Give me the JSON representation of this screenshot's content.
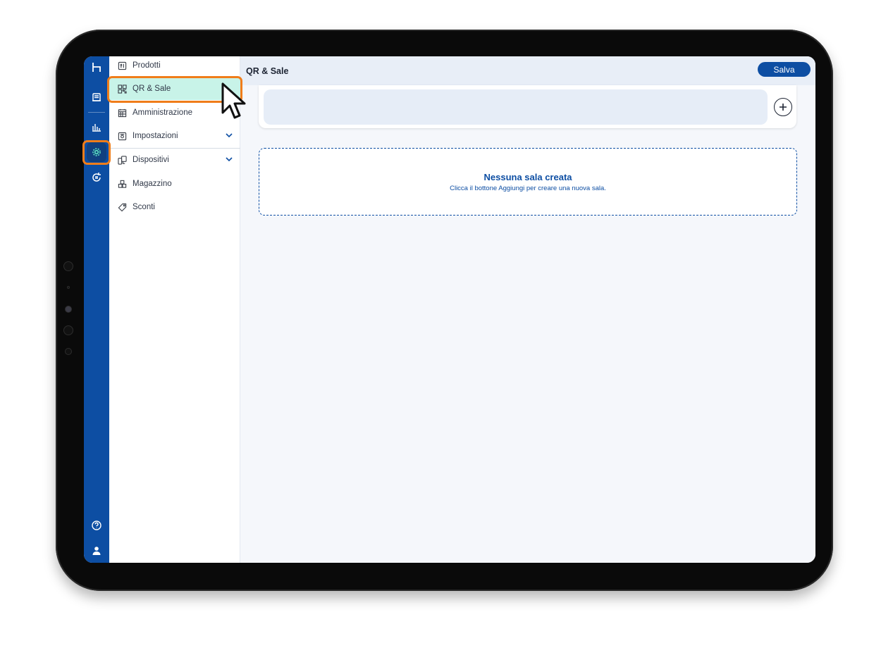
{
  "app": {
    "page_title": "QR & Sale",
    "save_label": "Salva"
  },
  "rail": {
    "items": [
      {
        "icon": "logo-icon"
      },
      {
        "icon": "receipt-icon"
      },
      {
        "icon": "bar-chart-icon"
      },
      {
        "icon": "gear-icon",
        "active": true
      },
      {
        "icon": "refresh-euro-icon"
      },
      {
        "icon": "help-icon"
      },
      {
        "icon": "user-icon"
      }
    ]
  },
  "sidebar": {
    "items": [
      {
        "label": "Prodotti",
        "icon": "menu-card-icon"
      },
      {
        "label": "QR & Sale",
        "icon": "qr-code-icon",
        "active": true
      },
      {
        "label": "Amministrazione",
        "icon": "calendar-grid-icon"
      },
      {
        "label": "Impostazioni",
        "icon": "settings-box-icon",
        "expandable": true
      },
      {
        "label": "Dispositivi",
        "icon": "devices-icon",
        "expandable": true
      },
      {
        "label": "Magazzino",
        "icon": "boxes-icon"
      },
      {
        "label": "Sconti",
        "icon": "tag-icon"
      }
    ]
  },
  "main": {
    "empty_title": "Nessuna sala creata",
    "empty_description": "Clicca il bottone Aggiungi per creare una nuova sala."
  },
  "colors": {
    "brand": "#0d4ea3",
    "active_menu": "#c8f3e8",
    "highlight": "#f07d1a"
  }
}
